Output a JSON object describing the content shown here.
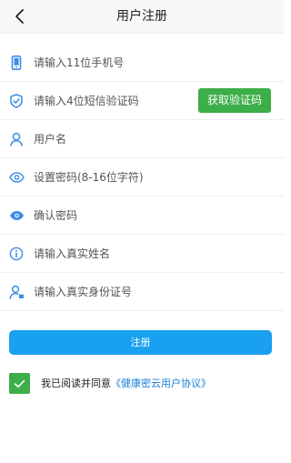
{
  "header": {
    "title": "用户注册",
    "back_icon": "chevron-left-icon"
  },
  "form": {
    "phone": {
      "placeholder": "请输入11位手机号",
      "icon": "phone-icon"
    },
    "sms_code": {
      "placeholder": "请输入4位短信验证码",
      "icon": "shield-check-icon",
      "button_label": "获取验证码"
    },
    "username": {
      "placeholder": "用户名",
      "icon": "user-icon"
    },
    "password": {
      "placeholder": "设置密码(8-16位字符)",
      "icon": "eye-outline-icon"
    },
    "confirm_password": {
      "placeholder": "确认密码",
      "icon": "eye-filled-icon"
    },
    "real_name": {
      "placeholder": "请输入真实姓名",
      "icon": "info-circle-icon"
    },
    "id_number": {
      "placeholder": "请输入真实身份证号",
      "icon": "user-id-icon"
    }
  },
  "register_button": {
    "label": "注册"
  },
  "agreement": {
    "checked": true,
    "text": "我已阅读并同意",
    "link_text": "《健康密云用户协议》"
  },
  "colors": {
    "accent_blue": "#1aa0f0",
    "icon_blue": "#3d8ce6",
    "green": "#3dae48",
    "link_blue": "#1a7fd4"
  }
}
